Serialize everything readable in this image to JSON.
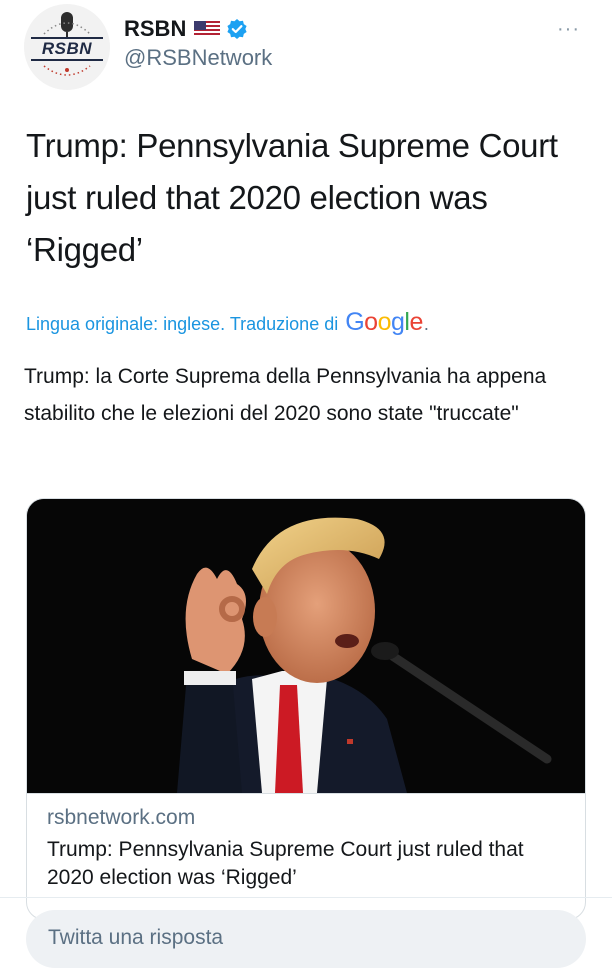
{
  "author": {
    "display_name": "RSBN",
    "handle": "@RSBNetwork",
    "avatar_text": "RSBN",
    "flag_icon": "us-flag-icon",
    "verified_icon": "verified-badge-icon",
    "verified_color": "#1da1f2"
  },
  "menu": {
    "more_label": "···"
  },
  "tweet": {
    "text": "Trump: Pennsylvania Supreme Court just ruled that 2020 election was ‘Rigged’"
  },
  "translation": {
    "note": "Lingua originale: inglese. Traduzione di",
    "provider": "Google",
    "provider_dot": ".",
    "text": "Trump: la Corte Suprema della Pennsylvania ha appena stabilito che le elezioni del 2020 sono state \"truccate\""
  },
  "card": {
    "image_alt": "photo-of-speaker-at-microphone",
    "domain": "rsbnetwork.com",
    "title": "Trump: Pennsylvania Supreme Court just ruled that 2020 election was ‘Rigged’"
  },
  "reply": {
    "placeholder": "Twitta una risposta"
  },
  "colors": {
    "link_blue": "#1b95e0",
    "secondary_text": "#5b7083",
    "primary_text": "#14171a",
    "google_blue": "#4285f4",
    "google_red": "#ea4335",
    "google_yellow": "#fbbc05",
    "google_green": "#34a853"
  }
}
